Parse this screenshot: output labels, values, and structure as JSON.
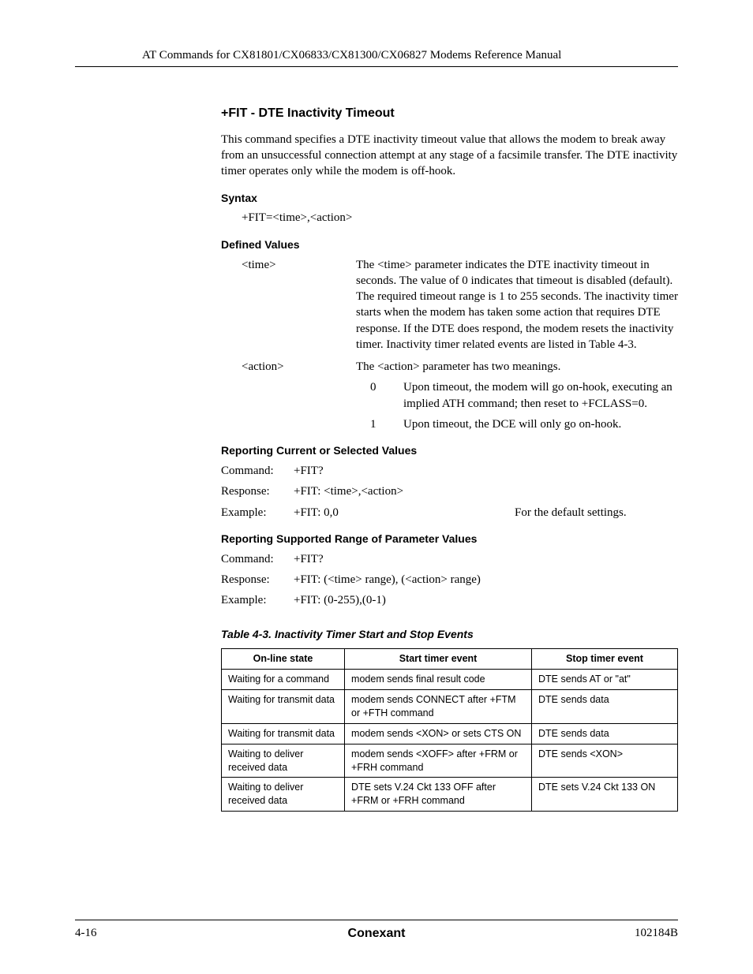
{
  "header": {
    "running_head": "AT Commands for CX81801/CX06833/CX81300/CX06827 Modems Reference Manual"
  },
  "section": {
    "title": "+FIT - DTE Inactivity Timeout",
    "intro": "This command specifies a DTE inactivity timeout value that allows the modem to break away from an unsuccessful connection attempt at any stage of a facsimile transfer. The DTE inactivity timer operates only while the modem is off-hook."
  },
  "syntax": {
    "heading": "Syntax",
    "text": "+FIT=<time>,<action>"
  },
  "defined": {
    "heading": "Defined Values",
    "time_term": "<time>",
    "time_desc": "The <time> parameter indicates the DTE inactivity timeout in seconds. The value of 0 indicates that timeout is disabled (default). The required timeout range is 1 to 255 seconds. The inactivity timer starts when the modem has taken some action that requires DTE response. If the DTE does respond, the modem resets the inactivity timer. Inactivity timer related events are listed in Table 4-3.",
    "action_term": "<action>",
    "action_desc": "The <action> parameter has two meanings.",
    "action_0_key": "0",
    "action_0_val": "Upon timeout, the modem will go on-hook, executing an implied ATH command; then reset to +FCLASS=0.",
    "action_1_key": "1",
    "action_1_val": "Upon timeout, the DCE will only go on-hook."
  },
  "report_current": {
    "heading": "Reporting Current or Selected Values",
    "cmd_label": "Command:",
    "cmd_val": "+FIT?",
    "resp_label": "Response:",
    "resp_val": "+FIT: <time>,<action>",
    "ex_label": "Example:",
    "ex_val": "+FIT: 0,0",
    "ex_note": "For the default settings."
  },
  "report_range": {
    "heading": "Reporting Supported Range of Parameter Values",
    "cmd_label": "Command:",
    "cmd_val": "+FIT?",
    "resp_label": "Response:",
    "resp_val": "+FIT: (<time> range), (<action> range)",
    "ex_label": "Example:",
    "ex_val": "+FIT: (0-255),(0-1)"
  },
  "table": {
    "caption": "Table 4-3. Inactivity Timer Start and Stop Events",
    "head": {
      "c1": "On-line state",
      "c2": "Start timer event",
      "c3": "Stop timer event"
    },
    "rows": [
      {
        "c1": "Waiting for a command",
        "c2": "modem sends final result code",
        "c3": "DTE sends AT or \"at\""
      },
      {
        "c1": "Waiting for transmit data",
        "c2": "modem sends CONNECT after +FTM or +FTH command",
        "c3": "DTE sends data"
      },
      {
        "c1": "Waiting for transmit data",
        "c2": "modem sends <XON> or sets CTS ON",
        "c3": "DTE sends data"
      },
      {
        "c1": "Waiting to deliver received data",
        "c2": "modem sends <XOFF> after +FRM or +FRH command",
        "c3": "DTE sends <XON>"
      },
      {
        "c1": "Waiting to deliver received data",
        "c2": "DTE sets V.24 Ckt 133 OFF after +FRM or +FRH command",
        "c3": "DTE sets V.24 Ckt 133 ON"
      }
    ]
  },
  "footer": {
    "left": "4-16",
    "center": "Conexant",
    "right": "102184B"
  }
}
